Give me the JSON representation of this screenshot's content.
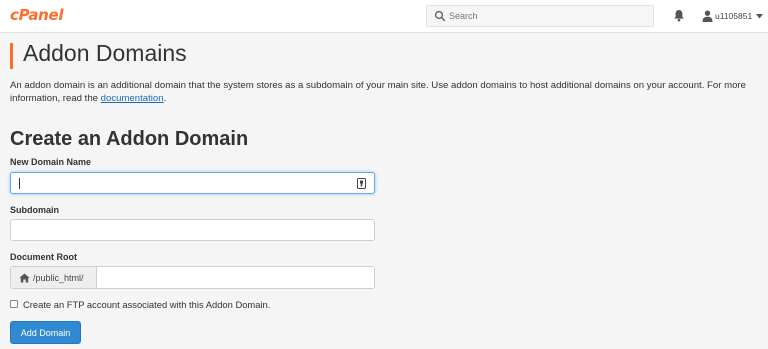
{
  "header": {
    "logo_text": "cPanel",
    "search_placeholder": "Search",
    "username": "u1105851",
    "brand_color": "#ff6c2c",
    "icons": [
      "search-icon",
      "bell-icon",
      "user-icon",
      "caret-down-icon"
    ]
  },
  "page": {
    "title": "Addon Domains",
    "description_text": "An addon domain is an additional domain that the system stores as a subdomain of your main site. Use addon domains to host additional domains on your account. For more information, read the ",
    "description_link": "documentation",
    "description_end": "."
  },
  "form": {
    "section_title": "Create an Addon Domain",
    "new_domain_label": "New Domain Name",
    "new_domain_value": "",
    "subdomain_label": "Subdomain",
    "subdomain_value": "",
    "document_root_label": "Document Root",
    "document_root_prefix": "/public_html/",
    "document_root_value": "",
    "ftp_checkbox_label": "Create an FTP account associated with this Addon Domain.",
    "ftp_checked": false,
    "submit_label": "Add Domain",
    "button_color": "#2f8ad2"
  }
}
